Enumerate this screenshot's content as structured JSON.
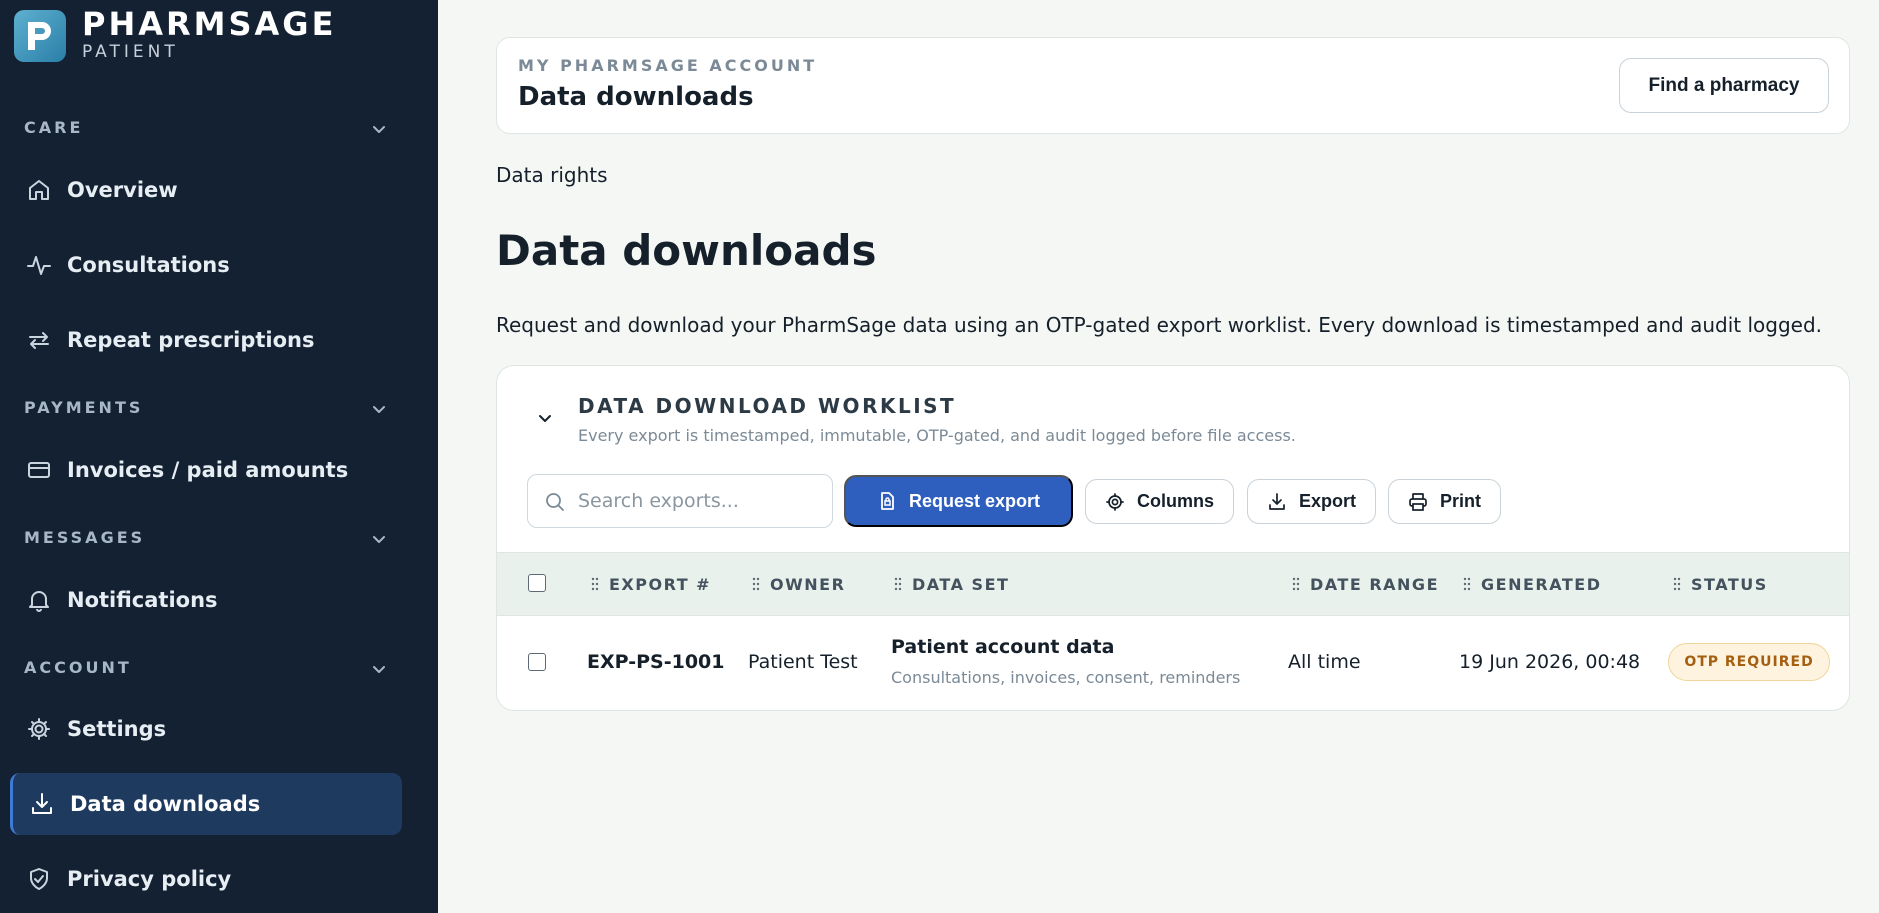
{
  "brand": {
    "name": "PHARMSAGE",
    "sub": "PATIENT",
    "logo_letter": "P"
  },
  "sidebar": {
    "sections": [
      {
        "label": "CARE"
      },
      {
        "label": "PAYMENTS"
      },
      {
        "label": "MESSAGES"
      },
      {
        "label": "ACCOUNT"
      }
    ],
    "items": [
      {
        "label": "Overview",
        "icon": "home-icon"
      },
      {
        "label": "Consultations",
        "icon": "activity-icon"
      },
      {
        "label": "Repeat prescriptions",
        "icon": "repeat-icon"
      },
      {
        "label": "Invoices / paid amounts",
        "icon": "credit-card-icon"
      },
      {
        "label": "Notifications",
        "icon": "bell-icon"
      },
      {
        "label": "Settings",
        "icon": "gear-icon"
      },
      {
        "label": "Data downloads",
        "icon": "download-icon",
        "active": true
      },
      {
        "label": "Privacy policy",
        "icon": "shield-check-icon"
      }
    ]
  },
  "header": {
    "overline": "MY PHARMSAGE ACCOUNT",
    "title": "Data downloads",
    "find_pharmacy": "Find a pharmacy"
  },
  "breadcrumb": "Data rights",
  "page": {
    "title": "Data downloads",
    "description": "Request and download your PharmSage data using an OTP-gated export worklist. Every download is timestamped and audit logged."
  },
  "worklist": {
    "title": "DATA DOWNLOAD WORKLIST",
    "subtitle": "Every export is timestamped, immutable, OTP-gated, and audit logged before file access.",
    "search_placeholder": "Search exports...",
    "request_export": "Request export",
    "columns": "Columns",
    "export": "Export",
    "print": "Print",
    "headers": [
      "EXPORT #",
      "OWNER",
      "DATA SET",
      "DATE RANGE",
      "GENERATED",
      "STATUS"
    ],
    "rows": [
      {
        "export_no": "EXP-PS-1001",
        "owner": "Patient Test",
        "data_set": "Patient account data",
        "data_set_detail": "Consultations, invoices, consent, reminders",
        "date_range": "All time",
        "generated": "19 Jun 2026, 00:48",
        "status": "OTP REQUIRED"
      }
    ]
  },
  "colors": {
    "sidebar_bg": "#142132",
    "active_bg": "#1f3a5f",
    "primary": "#2f5fbe",
    "status_bg": "#fdf3df",
    "status_text": "#a55f10"
  }
}
